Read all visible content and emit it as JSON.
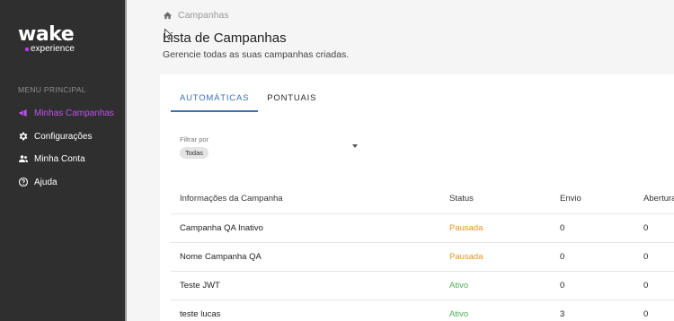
{
  "sidebar": {
    "logo_main": "wake",
    "logo_sub": "experience",
    "menu_header": "MENU PRINCIPAL",
    "items": [
      {
        "label": "Minhas Campanhas",
        "icon": "megaphone-icon",
        "active": true
      },
      {
        "label": "Configurações",
        "icon": "gear-icon",
        "active": false
      },
      {
        "label": "Minha Conta",
        "icon": "people-icon",
        "active": false
      },
      {
        "label": "Ajuda",
        "icon": "help-circle-icon",
        "active": false
      }
    ]
  },
  "breadcrumb": {
    "label": "Campanhas",
    "icon": "home-icon"
  },
  "page": {
    "title": "Lista de Campanhas",
    "subtitle": "Gerencie todas as suas campanhas criadas."
  },
  "tabs": [
    {
      "label": "AUTOMÁTICAS",
      "active": true
    },
    {
      "label": "PONTUAIS",
      "active": false
    }
  ],
  "filter": {
    "label": "Filtrar por",
    "value": "Todas"
  },
  "table": {
    "headers": [
      "Informações da Campanha",
      "Status",
      "Envio",
      "Abertura"
    ],
    "rows": [
      {
        "name": "Campanha QA Inativo",
        "status": "Pausada",
        "envio": "0",
        "abertura": "0"
      },
      {
        "name": "Nome Campanha QA",
        "status": "Pausada",
        "envio": "0",
        "abertura": "0"
      },
      {
        "name": "Teste JWT",
        "status": "Ativo",
        "envio": "0",
        "abertura": "0"
      },
      {
        "name": "teste lucas",
        "status": "Ativo",
        "envio": "3",
        "abertura": "0"
      }
    ]
  },
  "colors": {
    "sidebar_bg": "#2f2f2f",
    "accent_purple": "#c24df3",
    "tab_blue": "#3a71b8",
    "status_paused": "#e39624",
    "status_active": "#4caf50"
  }
}
